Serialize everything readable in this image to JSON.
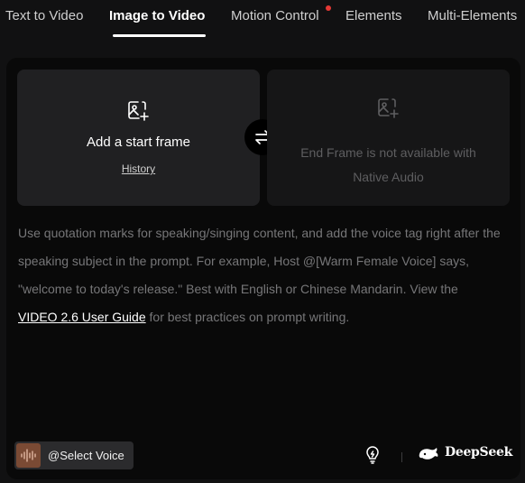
{
  "tabs": [
    {
      "label": "Text to Video",
      "active": false
    },
    {
      "label": "Image to Video",
      "active": true
    },
    {
      "label": "Motion Control",
      "active": false,
      "notification_dot": true
    },
    {
      "label": "Elements",
      "active": false
    },
    {
      "label": "Multi-Elements",
      "active": false
    }
  ],
  "start_frame": {
    "title": "Add a start frame",
    "history_link": "History",
    "icon": "image-add-icon"
  },
  "end_frame": {
    "line1": "End Frame is not available with",
    "line2": "Native Audio",
    "icon": "image-add-icon"
  },
  "swap": {
    "icon": "swap-arrows-icon"
  },
  "hint": {
    "text_before_link": "Use quotation marks for speaking/singing content, and add the voice tag right after the speaking subject in the prompt. For example, Host @[Warm Female Voice] says, \"welcome to today's release.\" Best with English or Chinese Mandarin. View the",
    "link": "VIDEO 2.6 User Guide",
    "text_after_link": "for best practices on prompt writing."
  },
  "footer": {
    "voice_button_label": "@Select Voice",
    "voice_icon": "audio-wave-icon",
    "bulb_icon": "lightbulb-icon",
    "model_brand": "DeepSeek",
    "model_icon": "deepseek-whale-icon"
  },
  "colors": {
    "background": "#111112",
    "panel": "#090909",
    "card": "#202022",
    "notification_dot": "#e53935",
    "voice_icon_bg": "#7a4a34"
  }
}
